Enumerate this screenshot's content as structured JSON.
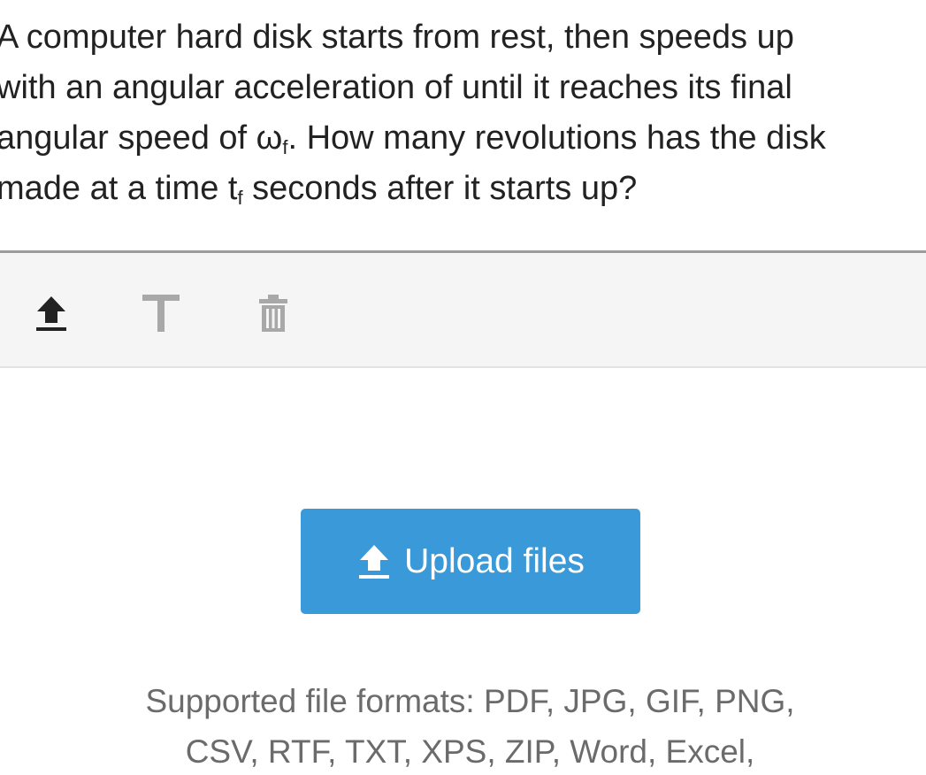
{
  "question": {
    "line1": "A computer hard disk starts from rest, then speeds up",
    "line2": "with an angular acceleration of until it reaches its final",
    "line3_prefix": "angular speed of ω",
    "line3_sub": "f",
    "line3_suffix": ". How many revolutions has the disk",
    "line4_prefix": "made at a time t",
    "line4_sub": "f",
    "line4_suffix": " seconds after it starts up?"
  },
  "toolbar": {
    "tools": [
      {
        "icon": "upload-icon",
        "color": "#222222"
      },
      {
        "icon": "text-icon",
        "color": "#a8a8a8"
      },
      {
        "icon": "trash-icon",
        "color": "#a8a8a8"
      }
    ]
  },
  "upload": {
    "button_label": "Upload files",
    "button_color": "#3a9ad9"
  },
  "formats": {
    "line1": "Supported file formats: PDF, JPG, GIF, PNG,",
    "line2": "CSV, RTF, TXT, XPS, ZIP, Word, Excel,"
  }
}
